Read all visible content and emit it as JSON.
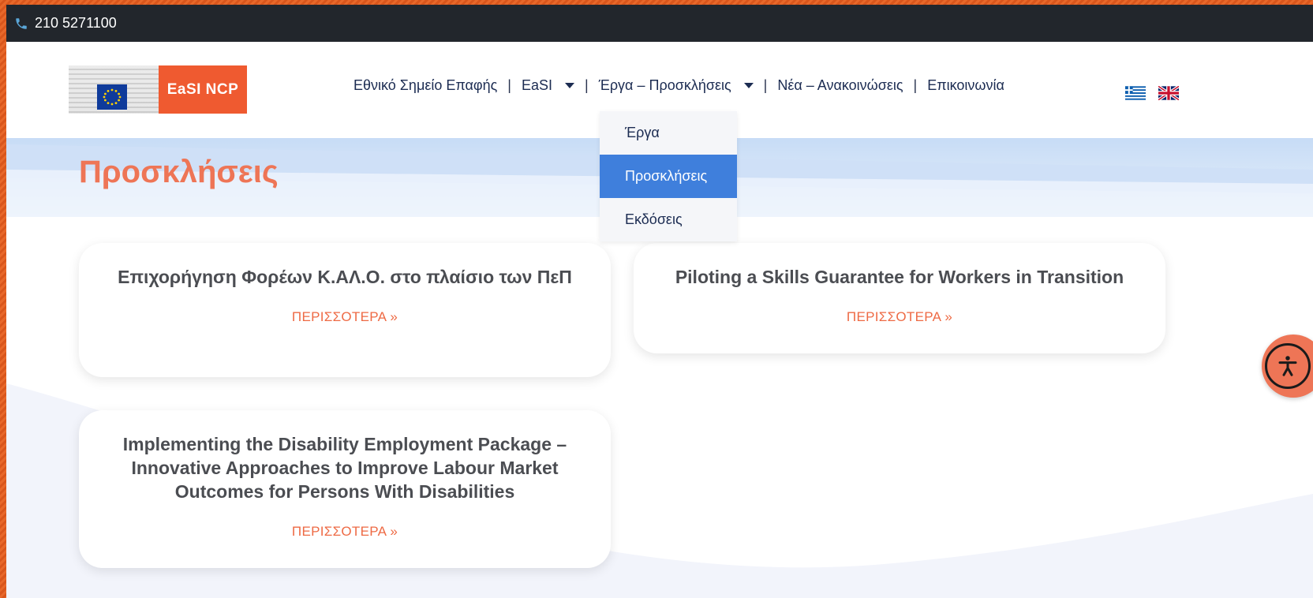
{
  "topbar": {
    "phone": "210 5271100",
    "phone_icon": "phone-icon"
  },
  "header": {
    "logo_text": "EaSI NCP",
    "nav": [
      {
        "label": "Εθνικό Σημείο Επαφής"
      },
      {
        "label": "EaSI"
      },
      {
        "label": "Έργα – Προσκλήσεις"
      },
      {
        "label": "Νέα – Ανακοινώσεις"
      },
      {
        "label": "Επικοινωνία"
      }
    ],
    "dropdown": [
      {
        "label": "Έργα"
      },
      {
        "label": "Προσκλήσεις"
      },
      {
        "label": "Εκδόσεις"
      }
    ]
  },
  "page": {
    "title": "Προσκλήσεις"
  },
  "cards": [
    {
      "title": "Επιχορήγηση Φορέων Κ.ΑΛ.Ο. στο πλαίσιο των ΠεΠ",
      "more": "ΠΕΡΙΣΣΟΤΕΡΑ »"
    },
    {
      "title": "Piloting a Skills Guarantee for Workers in Transition",
      "more": "ΠΕΡΙΣΣΟΤΕΡΑ »"
    },
    {
      "title": "Implementing the Disability Employment Package – Innovative Approaches to Improve Labour Market Outcomes for Persons With Disabilities",
      "more": "ΠΕΡΙΣΣΟΤΕΡΑ »"
    }
  ],
  "colors": {
    "accent": "#ee7556",
    "topbar": "#22262c",
    "active": "#3f7fdc",
    "logo": "#ef5a30"
  }
}
